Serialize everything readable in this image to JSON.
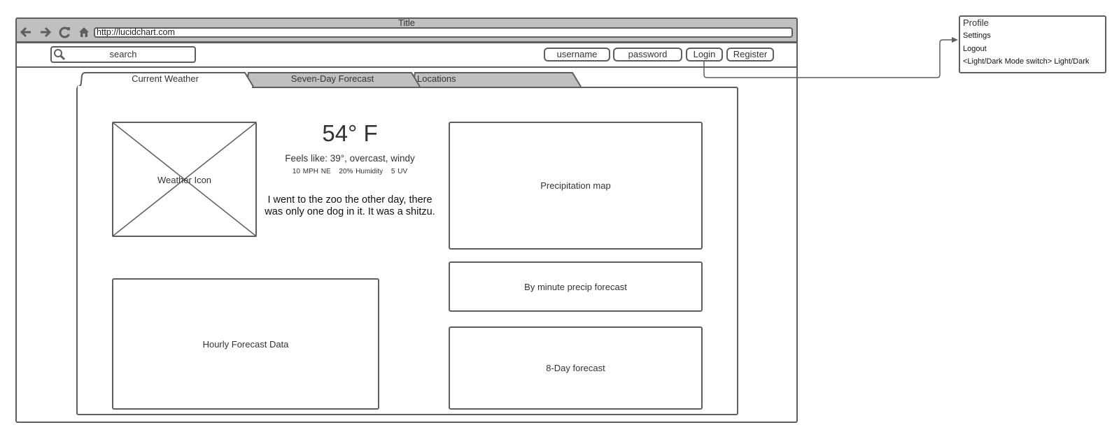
{
  "window": {
    "title": "Title",
    "url": "http://lucidchart.com",
    "nav_icons": [
      "back-arrow-icon",
      "forward-arrow-icon",
      "reload-icon",
      "home-icon"
    ]
  },
  "navbar": {
    "search_placeholder": "search",
    "username_placeholder": "username",
    "password_placeholder": "password",
    "login_label": "Login",
    "register_label": "Register"
  },
  "tabs": [
    {
      "label": "Current Weather",
      "active": true
    },
    {
      "label": "Seven-Day Forecast",
      "active": false
    },
    {
      "label": "Locations",
      "active": false
    }
  ],
  "current_weather": {
    "icon_placeholder_label": "Weather Icon",
    "temperature": "54° F",
    "feels_like": "Feels like: 39°, overcast, windy",
    "wind": "10 MPH NE",
    "humidity": "20% Humidity",
    "uv": "5 UV",
    "joke": "I went to the zoo the other day, there was only one dog in it. It was a shitzu."
  },
  "panels": {
    "precipitation_map": "Precipitation map",
    "by_minute": "By minute precip forecast",
    "eight_day": "8-Day forecast",
    "hourly": "Hourly Forecast Data"
  },
  "profile_menu": {
    "title": "Profile",
    "items": [
      "Settings",
      "Logout",
      "<Light/Dark Mode switch> Light/Dark"
    ]
  },
  "colors": {
    "stroke": "#5e5e5e",
    "chrome_fill": "#c0c0c0",
    "background": "#ffffff"
  }
}
